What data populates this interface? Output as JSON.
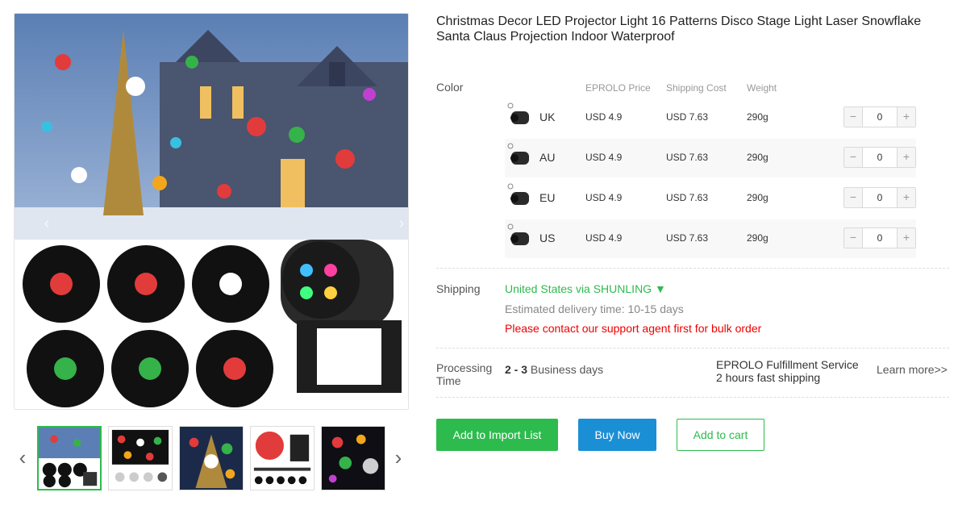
{
  "product": {
    "title_line1": "Christmas Decor LED Projector Light 16 Patterns Disco Stage Light Laser Snowflake",
    "title_line2": "Santa Claus Projection Indoor Waterproof"
  },
  "gallery": {
    "prev_arrow": "‹",
    "next_arrow": "›",
    "thumb_prev": "‹",
    "thumb_next": "›",
    "main_image": "christmas-projector-product-photo",
    "thumbnails": [
      {
        "name": "thumb-projection-scene",
        "active": true
      },
      {
        "name": "thumb-pattern-sheet",
        "active": false
      },
      {
        "name": "thumb-tree-closeup",
        "active": false
      },
      {
        "name": "thumb-feature-card",
        "active": false
      },
      {
        "name": "thumb-night-display",
        "active": false
      }
    ]
  },
  "variants": {
    "label": "Color",
    "headers": {
      "price": "EPROLO Price",
      "shipping": "Shipping Cost",
      "weight": "Weight"
    },
    "rows": [
      {
        "name": "UK",
        "price": "USD 4.9",
        "shipping": "USD 7.63",
        "weight": "290g",
        "qty": "0"
      },
      {
        "name": "AU",
        "price": "USD 4.9",
        "shipping": "USD 7.63",
        "weight": "290g",
        "qty": "0"
      },
      {
        "name": "EU",
        "price": "USD 4.9",
        "shipping": "USD 7.63",
        "weight": "290g",
        "qty": "0"
      },
      {
        "name": "US",
        "price": "USD 4.9",
        "shipping": "USD 7.63",
        "weight": "290g",
        "qty": "0"
      }
    ],
    "minus": "−",
    "plus": "+"
  },
  "shipping": {
    "label": "Shipping",
    "method": "United States via SHUNLING ▼",
    "estimate": "Estimated delivery time: 10-15 days",
    "warning": "Please contact our support agent first for bulk order"
  },
  "processing": {
    "label_line1": "Processing",
    "label_line2": "Time",
    "days": "2 - 3",
    "days_suffix": " Business days",
    "fulfillment_line1": "EPROLO Fulfillment Service",
    "fulfillment_line2": "2 hours fast shipping",
    "learn_more": "Learn more>>"
  },
  "actions": {
    "import": "Add to Import List",
    "buy": "Buy Now",
    "cart": "Add to cart"
  },
  "colors": {
    "accent_green": "#2dbb4d",
    "buy_blue": "#1b8fd6",
    "warning_red": "#ee0000"
  }
}
